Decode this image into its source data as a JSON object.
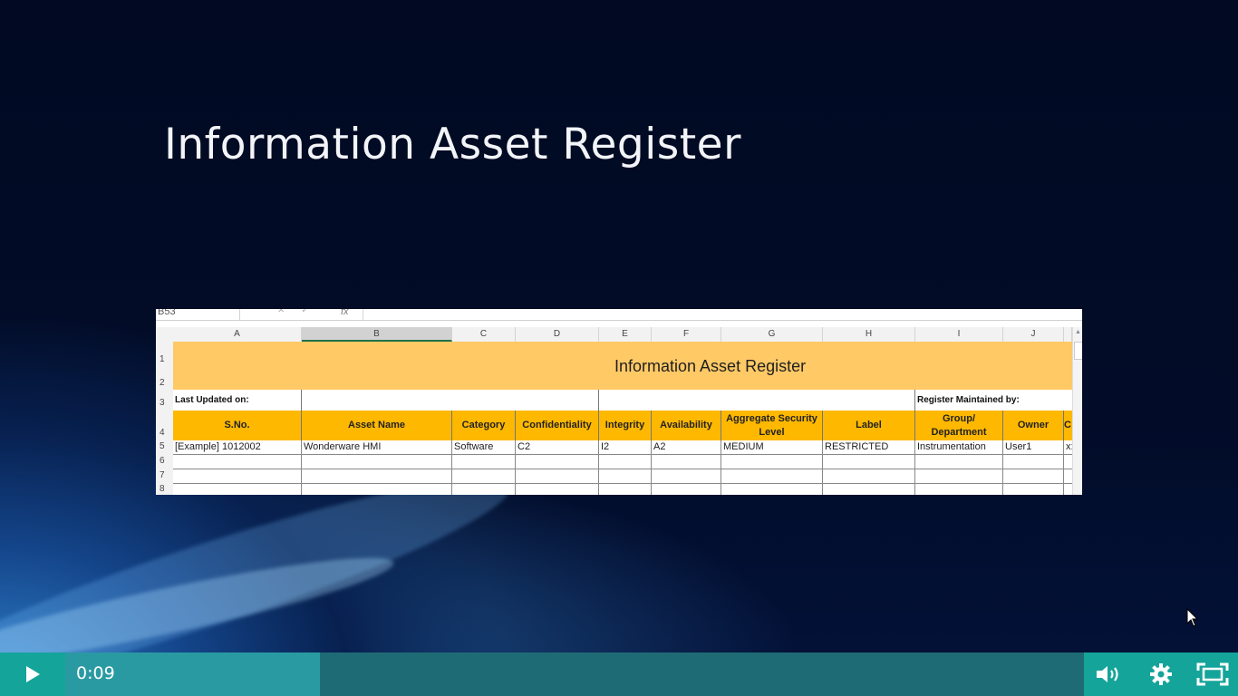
{
  "slide": {
    "title": "Information Asset Register"
  },
  "spreadsheet": {
    "name_box": "B53",
    "formula_icon": "fx",
    "column_letters": [
      "A",
      "B",
      "C",
      "D",
      "E",
      "F",
      "G",
      "H",
      "I",
      "J",
      ""
    ],
    "row_numbers": [
      "1",
      "2",
      "3",
      "4",
      "5",
      "6",
      "7",
      "8"
    ],
    "title": "Information Asset Register",
    "last_updated_label": "Last Updated on:",
    "maintained_by_label": "Register Maintained by:",
    "headers": [
      "S.No.",
      "Asset Name",
      "Category",
      "Confidentiality",
      "Integrity",
      "Availability",
      "Aggregate Security Level",
      "Label",
      "Group/ Department",
      "Owner",
      "C"
    ],
    "rows": [
      [
        "[Example] 1012002",
        "Wonderware HMI",
        "Software",
        "C2",
        "I2",
        "A2",
        "MEDIUM",
        "RESTRICTED",
        "Instrumentation",
        "User1",
        "x:"
      ]
    ],
    "accent_header_color": "#ffb800",
    "title_band_color": "#ffc966"
  },
  "player": {
    "time": "0:09",
    "progress_fraction": 0.25,
    "accent_color": "#15a49a",
    "icons": [
      "play-icon",
      "volume-icon",
      "settings-icon",
      "fullscreen-icon"
    ]
  }
}
